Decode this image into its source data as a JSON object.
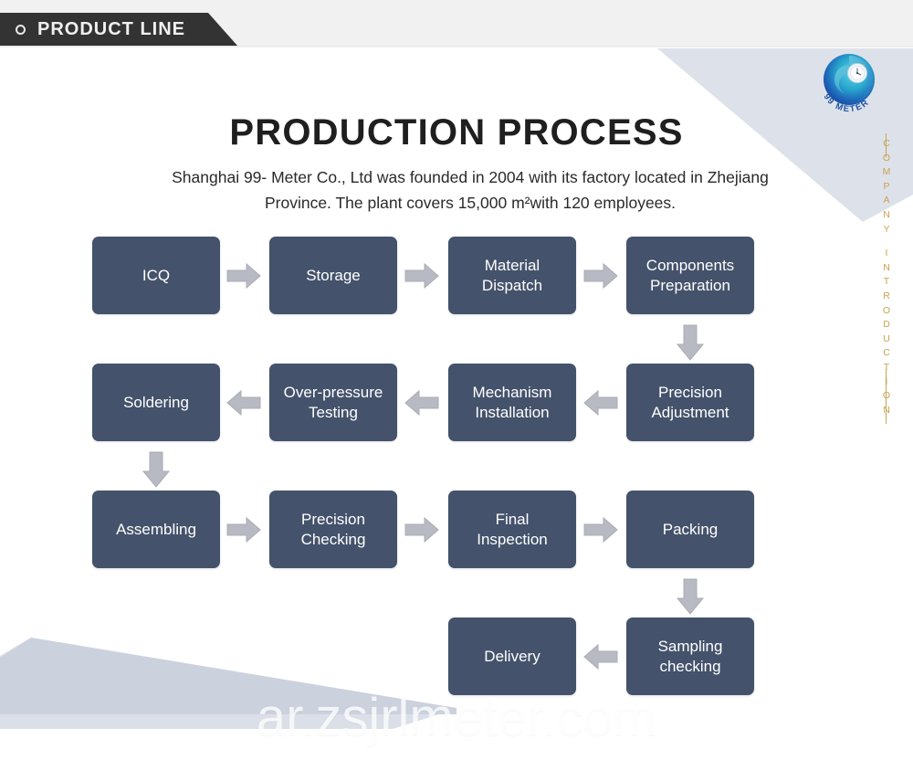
{
  "header": {
    "banner_label": "PRODUCT LINE",
    "icon": "circle-outline-icon"
  },
  "logo": {
    "name": "99-meter-logo",
    "brand_text": "99 METER"
  },
  "side_label": {
    "text": "COMPANY INTRODUCTION",
    "color": "#c8a44f"
  },
  "main": {
    "title": "PRODUCTION PROCESS",
    "subtitle_line1": "Shanghai 99- Meter Co., Ltd was founded in 2004 with its factory located in Zhejiang",
    "subtitle_line2": "Province. The plant covers 15,000 m²with 120 employees."
  },
  "colors": {
    "box_fill": "#44526b",
    "arrow_fill": "#b7bac2",
    "banner_bg": "#333333",
    "gold": "#c8a44f",
    "deco_blue_gray": "#d5d9e4"
  },
  "flow": {
    "boxes": [
      {
        "id": "icq",
        "label_line1": "ICQ",
        "label_line2": ""
      },
      {
        "id": "storage",
        "label_line1": "Storage",
        "label_line2": ""
      },
      {
        "id": "material",
        "label_line1": "Material",
        "label_line2": "Dispatch"
      },
      {
        "id": "components",
        "label_line1": "Components",
        "label_line2": "Preparation"
      },
      {
        "id": "soldering",
        "label_line1": "Soldering",
        "label_line2": ""
      },
      {
        "id": "overpressure",
        "label_line1": "Over-pressure",
        "label_line2": "Testing"
      },
      {
        "id": "mechanism",
        "label_line1": "Mechanism",
        "label_line2": "Installation"
      },
      {
        "id": "precision-adj",
        "label_line1": "Precision",
        "label_line2": "Adjustment"
      },
      {
        "id": "assembling",
        "label_line1": "Assembling",
        "label_line2": ""
      },
      {
        "id": "precision-chk",
        "label_line1": "Precision",
        "label_line2": "Checking"
      },
      {
        "id": "final",
        "label_line1": "Final",
        "label_line2": "Inspection"
      },
      {
        "id": "packing",
        "label_line1": "Packing",
        "label_line2": ""
      },
      {
        "id": "delivery",
        "label_line1": "Delivery",
        "label_line2": ""
      },
      {
        "id": "sampling",
        "label_line1": "Sampling",
        "label_line2": "checking"
      }
    ],
    "arrows": [
      {
        "id": "icq-to-storage",
        "direction": "right"
      },
      {
        "id": "storage-to-material",
        "direction": "right"
      },
      {
        "id": "material-to-components",
        "direction": "right"
      },
      {
        "id": "components-to-precision",
        "direction": "down"
      },
      {
        "id": "precision-to-mechanism",
        "direction": "left"
      },
      {
        "id": "mechanism-to-overpressure",
        "direction": "left"
      },
      {
        "id": "overpressure-to-soldering",
        "direction": "left"
      },
      {
        "id": "soldering-to-assembling",
        "direction": "down"
      },
      {
        "id": "assembling-to-precisionchk",
        "direction": "right"
      },
      {
        "id": "precisionchk-to-final",
        "direction": "right"
      },
      {
        "id": "final-to-packing",
        "direction": "right"
      },
      {
        "id": "packing-to-sampling",
        "direction": "down"
      },
      {
        "id": "sampling-to-delivery",
        "direction": "left"
      }
    ]
  },
  "watermark": {
    "text": "ar.zsjrlmeter.com"
  }
}
